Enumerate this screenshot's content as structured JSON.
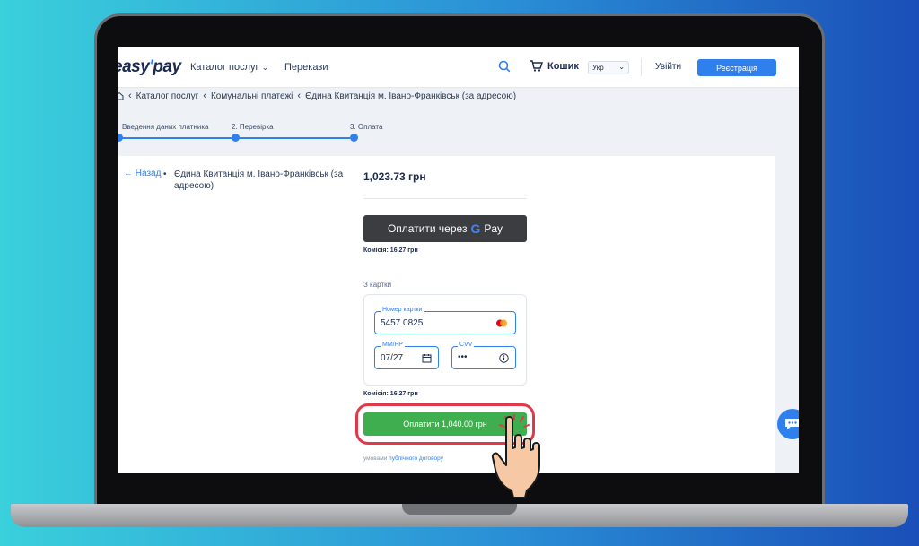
{
  "header": {
    "logo_text_a": "easy",
    "logo_text_b": "pay",
    "nav": [
      "Каталог послуг",
      "Перекази"
    ],
    "cart_label": "Кошик",
    "lang": "Укр",
    "login_label": "Увійти",
    "register_label": "Реєстрація"
  },
  "breadcrumb": [
    "Каталог послуг",
    "Комунальні платежі",
    "Єдина Квитанція м. Івано-Франківськ (за адресою)"
  ],
  "steps": [
    "Введення даних платника",
    "2. Перевірка",
    "3. Оплата"
  ],
  "payment": {
    "back_label": "Назад",
    "service_name": "Єдина Квитанція м. Івано-Франківськ (за адресою)",
    "amount": "1,023.73 грн",
    "gpay_label": "Оплатити через",
    "gpay_brand_g": "G",
    "gpay_brand": "Pay",
    "commission_label": "Комісія:",
    "commission_value": "16.27 грн",
    "from_card_label": "З картки",
    "card_number_label": "Номер картки",
    "card_number_value": "5457 0825",
    "expiry_label": "ММ/РР",
    "expiry_value": "07/27",
    "cvv_label": "CVV",
    "cvv_value": "•••",
    "pay_button_label": "Оплатити 1,040.00 грн",
    "terms_prefix": "умовами",
    "terms_link": "публічного договору"
  },
  "colors": {
    "accent": "#2f80ed",
    "pay_green": "#3fae4f",
    "highlight_red": "#e03a4a"
  }
}
